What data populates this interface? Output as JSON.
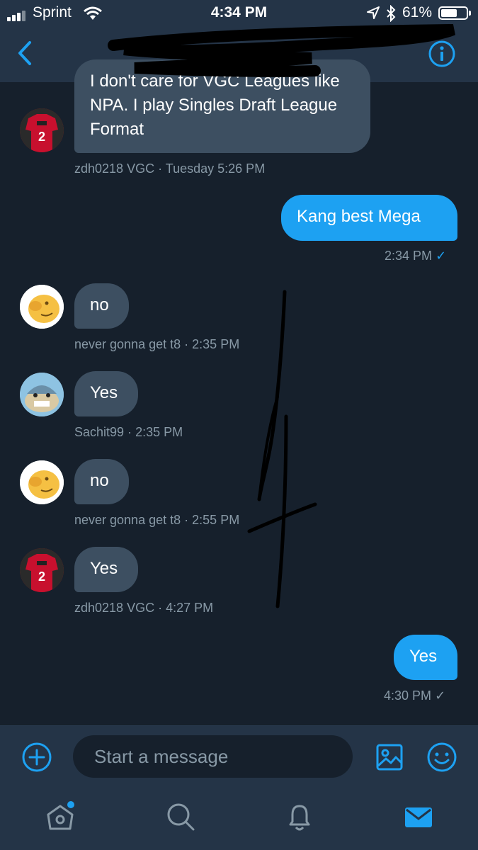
{
  "status_bar": {
    "carrier": "Sprint",
    "time": "4:34 PM",
    "battery": "61%"
  },
  "messages": [
    {
      "side": "in",
      "text": "I don't care for VGC Leagues like NPA. I play Singles Draft League Format",
      "sender": "zdh0218 VGC",
      "time": "Tuesday 5:26 PM",
      "avatar": "jersey-avatar"
    },
    {
      "side": "out",
      "text": "Kang best Mega",
      "time": "2:34 PM",
      "status": "✓"
    },
    {
      "side": "in",
      "text": "no",
      "sender": "never gonna get t8",
      "time": "2:35 PM",
      "avatar": "yellow-avatar"
    },
    {
      "side": "in",
      "text": "Yes",
      "sender": "Sachit99",
      "time": "2:35 PM",
      "avatar": "pokemon-avatar"
    },
    {
      "side": "in",
      "text": "no",
      "sender": "never gonna get t8",
      "time": "2:55 PM",
      "avatar": "yellow-avatar"
    },
    {
      "side": "in",
      "text": "Yes",
      "sender": "zdh0218 VGC",
      "time": "4:27 PM",
      "avatar": "jersey-avatar"
    },
    {
      "side": "out",
      "text": "Yes",
      "time": "4:30 PM",
      "status": "✓"
    }
  ],
  "meta_separator": "·",
  "composer": {
    "placeholder": "Start a message"
  },
  "tabs": [
    "home-icon",
    "search-icon",
    "notifications-icon",
    "messages-icon"
  ],
  "colors": {
    "accent": "#1da1f2",
    "background": "#16202c",
    "header": "#243447",
    "incoming_bubble": "#3d4f61",
    "meta_text": "#8899a6"
  }
}
